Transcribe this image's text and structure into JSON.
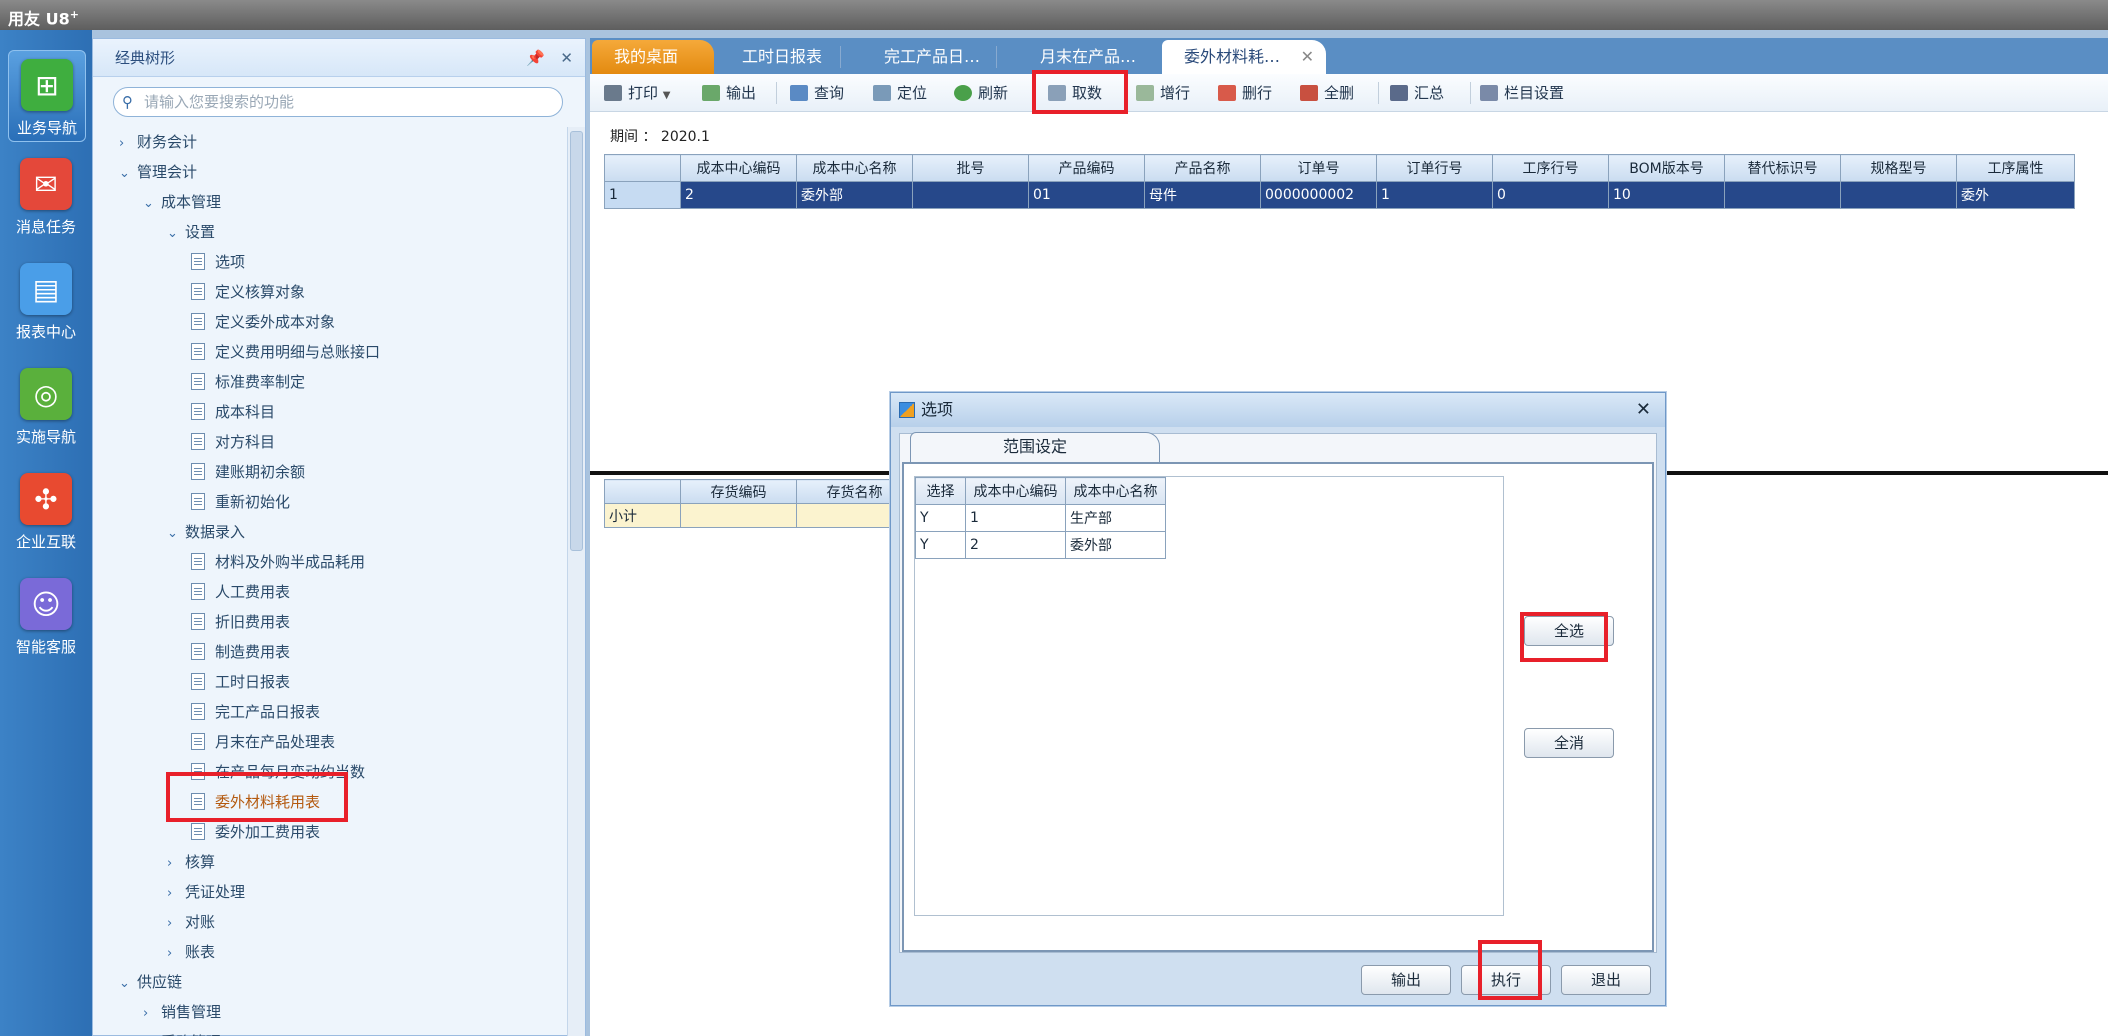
{
  "app": {
    "title": "用友 U8",
    "title_sup": "+"
  },
  "leftnav": [
    {
      "label": "业务导航",
      "icon": "business-nav-icon"
    },
    {
      "label": "消息任务",
      "icon": "message-icon"
    },
    {
      "label": "报表中心",
      "icon": "report-icon"
    },
    {
      "label": "实施导航",
      "icon": "compass-icon"
    },
    {
      "label": "企业互联",
      "icon": "connect-icon"
    },
    {
      "label": "智能客服",
      "icon": "support-icon"
    }
  ],
  "sidebar": {
    "title": "经典树形",
    "search_placeholder": "请输入您要搜索的功能",
    "tree": [
      {
        "label": "财务会计",
        "type": "folder",
        "expanded": false
      },
      {
        "label": "管理会计",
        "type": "folder",
        "expanded": true
      },
      {
        "label": "成本管理",
        "type": "folder",
        "expanded": true
      },
      {
        "label": "设置",
        "type": "folder",
        "expanded": true
      },
      {
        "label": "选项",
        "type": "doc"
      },
      {
        "label": "定义核算对象",
        "type": "doc"
      },
      {
        "label": "定义委外成本对象",
        "type": "doc"
      },
      {
        "label": "定义费用明细与总账接口",
        "type": "doc"
      },
      {
        "label": "标准费率制定",
        "type": "doc"
      },
      {
        "label": "成本科目",
        "type": "doc"
      },
      {
        "label": "对方科目",
        "type": "doc"
      },
      {
        "label": "建账期初余额",
        "type": "doc"
      },
      {
        "label": "重新初始化",
        "type": "doc"
      },
      {
        "label": "数据录入",
        "type": "folder",
        "expanded": true
      },
      {
        "label": "材料及外购半成品耗用",
        "type": "doc"
      },
      {
        "label": "人工费用表",
        "type": "doc"
      },
      {
        "label": "折旧费用表",
        "type": "doc"
      },
      {
        "label": "制造费用表",
        "type": "doc"
      },
      {
        "label": "工时日报表",
        "type": "doc"
      },
      {
        "label": "完工产品日报表",
        "type": "doc"
      },
      {
        "label": "月末在产品处理表",
        "type": "doc"
      },
      {
        "label": "在产品每月变动约当数",
        "type": "doc"
      },
      {
        "label": "委外材料耗用表",
        "type": "doc",
        "selected": true
      },
      {
        "label": "委外加工费用表",
        "type": "doc"
      },
      {
        "label": "核算",
        "type": "folder",
        "expanded": false
      },
      {
        "label": "凭证处理",
        "type": "folder",
        "expanded": false
      },
      {
        "label": "对账",
        "type": "folder",
        "expanded": false
      },
      {
        "label": "账表",
        "type": "folder",
        "expanded": false
      },
      {
        "label": "供应链",
        "type": "folder",
        "expanded": true
      },
      {
        "label": "销售管理",
        "type": "folder",
        "expanded": false
      },
      {
        "label": "采购管理",
        "type": "folder",
        "expanded": true
      }
    ]
  },
  "tabs": [
    {
      "label": "我的桌面"
    },
    {
      "label": "工时日报表"
    },
    {
      "label": "完工产品日…"
    },
    {
      "label": "月末在产品…"
    },
    {
      "label": "委外材料耗…"
    }
  ],
  "toolbar": [
    {
      "label": "打印",
      "icon": "print-icon"
    },
    {
      "label": "输出",
      "icon": "export-icon"
    },
    {
      "label": "查询",
      "icon": "query-icon"
    },
    {
      "label": "定位",
      "icon": "locate-icon"
    },
    {
      "label": "刷新",
      "icon": "refresh-icon"
    },
    {
      "label": "取数",
      "icon": "fetch-data-icon"
    },
    {
      "label": "增行",
      "icon": "add-row-icon"
    },
    {
      "label": "删行",
      "icon": "delete-row-icon"
    },
    {
      "label": "全删",
      "icon": "delete-all-icon"
    },
    {
      "label": "汇总",
      "icon": "sum-icon"
    },
    {
      "label": "栏目设置",
      "icon": "column-settings-icon"
    }
  ],
  "period": {
    "label": "期间 ：",
    "value": "2020.1"
  },
  "grid": {
    "columns": [
      "成本中心编码",
      "成本中心名称",
      "批号",
      "产品编码",
      "产品名称",
      "订单号",
      "订单行号",
      "工序行号",
      "BOM版本号",
      "替代标识号",
      "规格型号",
      "工序属性"
    ],
    "rows": [
      {
        "rownum": "1",
        "cells": [
          "2",
          "委外部",
          "",
          "01",
          "母件",
          "0000000002",
          "1",
          "0",
          "10",
          "",
          "",
          "委外"
        ]
      }
    ]
  },
  "grid2": {
    "columns": [
      "存货编码",
      "存货名称"
    ],
    "subtotal_label": "小计"
  },
  "dialog": {
    "title": "选项",
    "tab_label": "范围设定",
    "columns": [
      "选择",
      "成本中心编码",
      "成本中心名称"
    ],
    "rows": [
      [
        "Y",
        "1",
        "生产部"
      ],
      [
        "Y",
        "2",
        "委外部"
      ]
    ],
    "select_all": "全选",
    "clear_all": "全消",
    "output": "输出",
    "execute": "执行",
    "exit": "退出"
  }
}
